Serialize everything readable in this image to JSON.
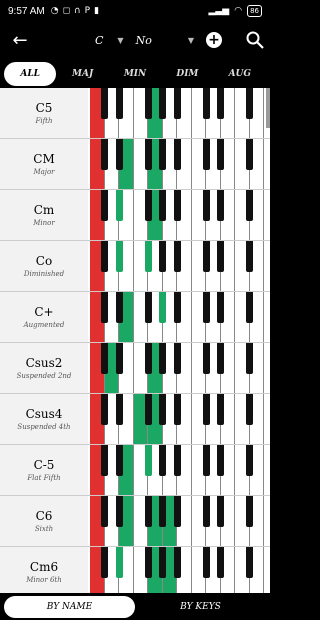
{
  "status": {
    "time": "9:57 AM",
    "battery": "86"
  },
  "appbar": {
    "key": "C",
    "inversion": "No"
  },
  "tabs": [
    "ALL",
    "MAJ",
    "MIN",
    "DIM",
    "AUG"
  ],
  "chords": [
    {
      "name": "C5",
      "sub": "Fifth",
      "notes": [
        0,
        7
      ]
    },
    {
      "name": "CM",
      "sub": "Major",
      "notes": [
        0,
        4,
        7
      ]
    },
    {
      "name": "Cm",
      "sub": "Minor",
      "notes": [
        0,
        3,
        7
      ]
    },
    {
      "name": "Co",
      "sub": "Diminished",
      "notes": [
        0,
        3,
        6
      ]
    },
    {
      "name": "C+",
      "sub": "Augmented",
      "notes": [
        0,
        4,
        8
      ]
    },
    {
      "name": "Csus2",
      "sub": "Suspended 2nd",
      "notes": [
        0,
        2,
        7
      ]
    },
    {
      "name": "Csus4",
      "sub": "Suspended 4th",
      "notes": [
        0,
        5,
        7
      ]
    },
    {
      "name": "C-5",
      "sub": "Flat Fifth",
      "notes": [
        0,
        4,
        6
      ]
    },
    {
      "name": "C6",
      "sub": "Sixth",
      "notes": [
        0,
        4,
        7,
        9
      ]
    },
    {
      "name": "Cm6",
      "sub": "Minor 6th",
      "notes": [
        0,
        3,
        7,
        9
      ]
    }
  ],
  "colors": {
    "root": "#e03030",
    "note": "#1aa864"
  },
  "bottom_tabs": [
    "BY NAME",
    "BY KEYS"
  ]
}
